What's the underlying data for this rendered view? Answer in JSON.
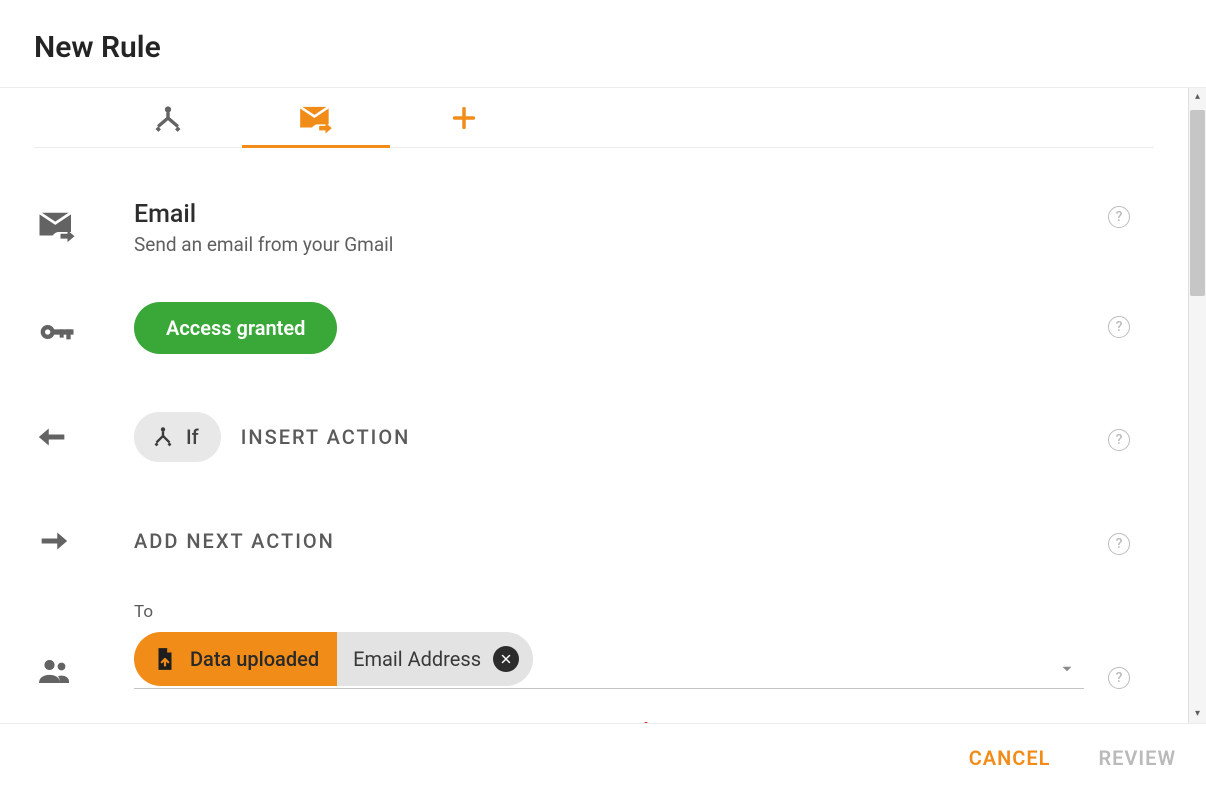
{
  "header": {
    "title": "New Rule"
  },
  "tabs": {
    "trigger_icon": "trigger-icon",
    "email_icon": "email-forward-icon",
    "add_icon": "plus-icon"
  },
  "email": {
    "title": "Email",
    "desc": "Send an email from your Gmail"
  },
  "access": {
    "label": "Access granted"
  },
  "if_row": {
    "if": "If",
    "insert": "INSERT ACTION"
  },
  "next": {
    "label": "ADD NEXT ACTION"
  },
  "to": {
    "label": "To",
    "chip_source": "Data uploaded",
    "chip_field": "Email Address"
  },
  "footer": {
    "cancel": "CANCEL",
    "review": "REVIEW"
  }
}
